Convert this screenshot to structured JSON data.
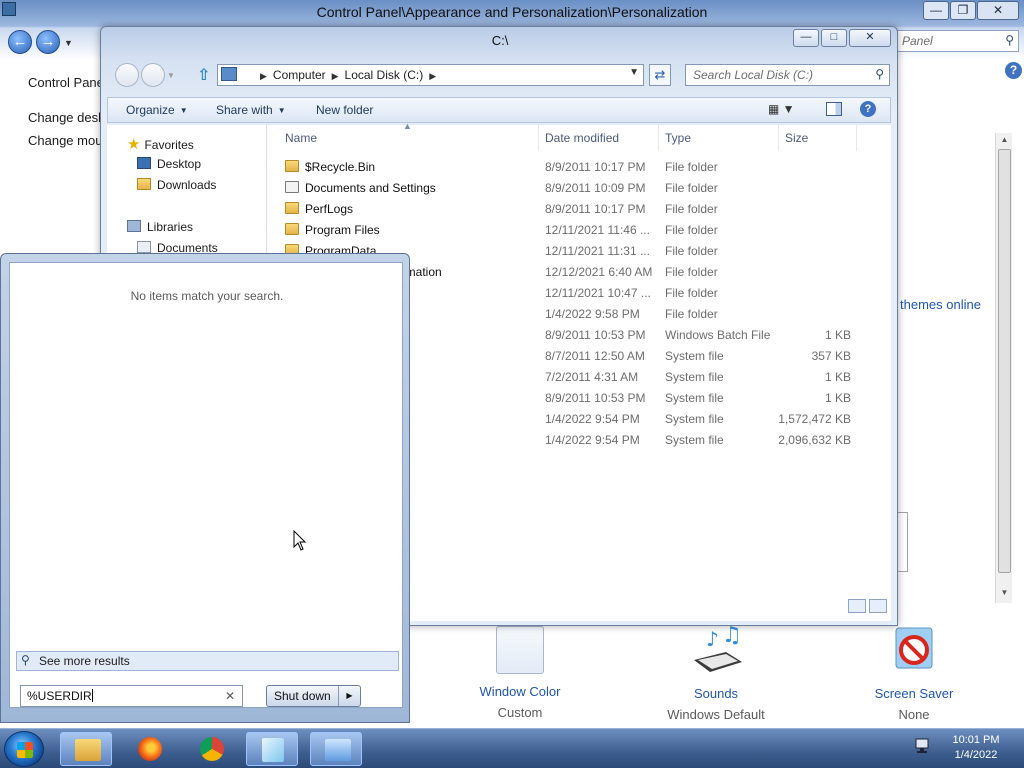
{
  "control_panel": {
    "title": "Control Panel\\Appearance and Personalization\\Personalization",
    "search_placeholder": "Search Control Panel",
    "search_visible": "Panel",
    "help": "?",
    "sidebar": [
      "Control Panel Home",
      "Change desktop icons",
      "Change mouse pointers"
    ],
    "sidebar_visible": [
      "Control Pane",
      "Change desk",
      "Change mou"
    ],
    "themes_link": "themes online",
    "items": [
      {
        "label": "Window Color",
        "sub": "Custom"
      },
      {
        "label": "Sounds",
        "sub": "Windows Default"
      },
      {
        "label": "Screen Saver",
        "sub": "None"
      }
    ]
  },
  "explorer": {
    "title": "C:\\",
    "address": [
      "Computer",
      "Local Disk (C:)"
    ],
    "search_placeholder": "Search Local Disk (C:)",
    "commands": [
      "Organize",
      "Share with",
      "New folder"
    ],
    "nav": {
      "favorites_label": "Favorites",
      "favorites": [
        "Desktop",
        "Downloads"
      ],
      "libraries_label": "Libraries",
      "libraries": [
        "Documents"
      ]
    },
    "columns": [
      "Name",
      "Date modified",
      "Type",
      "Size"
    ],
    "files": [
      {
        "name": "$Recycle.Bin",
        "date": "8/9/2011 10:17 PM",
        "type": "File folder",
        "size": ""
      },
      {
        "name": "Documents and Settings",
        "date": "8/9/2011 10:09 PM",
        "type": "File folder",
        "size": ""
      },
      {
        "name": "PerfLogs",
        "date": "8/9/2011 10:17 PM",
        "type": "File folder",
        "size": ""
      },
      {
        "name": "Program Files",
        "date": "12/11/2021 11:46 ...",
        "type": "File folder",
        "size": ""
      },
      {
        "name": "ProgramData",
        "date": "12/11/2021 11:31 ...",
        "type": "File folder",
        "size": ""
      },
      {
        "name": "ormation",
        "date": "12/12/2021 6:40 AM",
        "type": "File folder",
        "size": ""
      },
      {
        "name": "",
        "date": "12/11/2021 10:47 ...",
        "type": "File folder",
        "size": ""
      },
      {
        "name": "",
        "date": "1/4/2022 9:58 PM",
        "type": "File folder",
        "size": ""
      },
      {
        "name": "",
        "date": "8/9/2011 10:53 PM",
        "type": "Windows Batch File",
        "size": "1 KB"
      },
      {
        "name": "",
        "date": "8/7/2011 12:50 AM",
        "type": "System file",
        "size": "357 KB"
      },
      {
        "name": "",
        "date": "7/2/2011 4:31 AM",
        "type": "System file",
        "size": "1 KB"
      },
      {
        "name": "",
        "date": "8/9/2011 10:53 PM",
        "type": "System file",
        "size": "1 KB"
      },
      {
        "name": "",
        "date": "1/4/2022 9:54 PM",
        "type": "System file",
        "size": "1,572,472 KB"
      },
      {
        "name": "",
        "date": "1/4/2022 9:54 PM",
        "type": "System file",
        "size": "2,096,632 KB"
      }
    ]
  },
  "start_menu": {
    "no_items": "No items match your search.",
    "see_more": "See more results",
    "search_value": "%USERDIR",
    "shutdown": "Shut down"
  },
  "taskbar": {
    "time": "10:01 PM",
    "date": "1/4/2022",
    "apps": [
      "Windows Explorer",
      "Firefox",
      "Chrome",
      "Notepad",
      "Control Panel"
    ]
  },
  "colors": {
    "link": "#1f56b0",
    "taskbar": "#3d5e8f",
    "folder": "#e3b44a"
  }
}
